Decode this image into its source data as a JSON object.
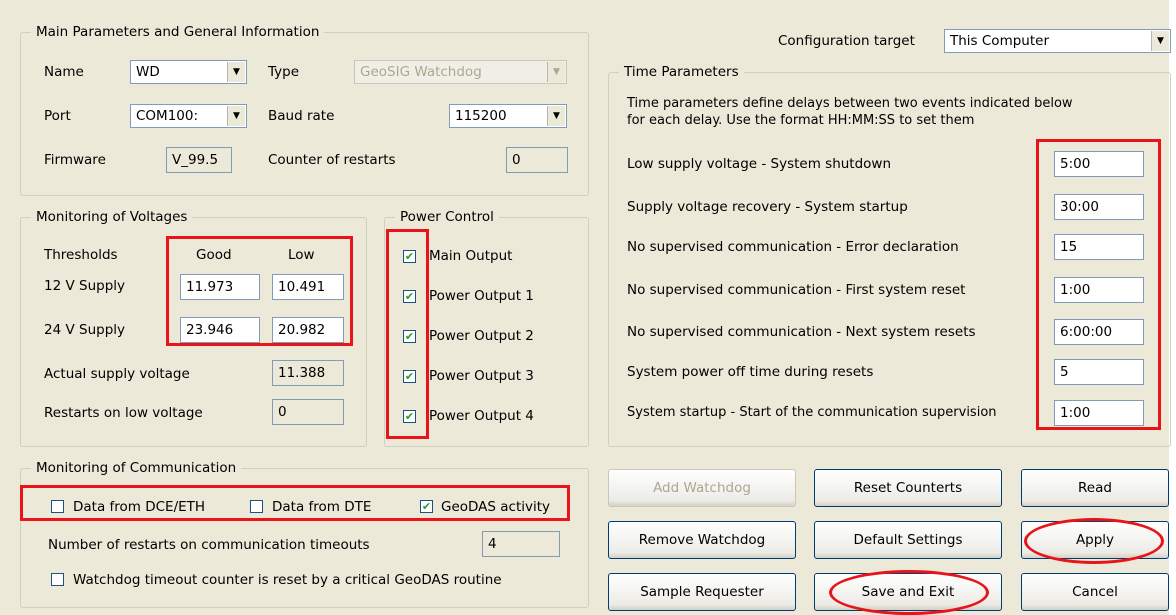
{
  "main_params": {
    "legend": "Main Parameters and General Information",
    "name_label": "Name",
    "name_value": "WD",
    "type_label": "Type",
    "type_value": "GeoSIG Watchdog",
    "port_label": "Port",
    "port_value": "COM100:",
    "baud_label": "Baud rate",
    "baud_value": "115200",
    "firmware_label": "Firmware",
    "firmware_value": "V_99.5",
    "restarts_label": "Counter of restarts",
    "restarts_value": "0"
  },
  "voltages": {
    "legend": "Monitoring of Voltages",
    "thresholds_label": "Thresholds",
    "good_header": "Good",
    "low_header": "Low",
    "supply12_label": "12 V Supply",
    "supply12_good": "11.973",
    "supply12_low": "10.491",
    "supply24_label": "24 V Supply",
    "supply24_good": "23.946",
    "supply24_low": "20.982",
    "actual_label": "Actual supply voltage",
    "actual_value": "11.388",
    "lowrestart_label": "Restarts on low voltage",
    "lowrestart_value": "0"
  },
  "power": {
    "legend": "Power Control",
    "outputs": [
      {
        "label": "Main Output",
        "checked": true
      },
      {
        "label": "Power Output 1",
        "checked": true
      },
      {
        "label": "Power Output 2",
        "checked": true
      },
      {
        "label": "Power Output 3",
        "checked": true
      },
      {
        "label": "Power Output 4",
        "checked": true
      }
    ]
  },
  "comm": {
    "legend": "Monitoring of Communication",
    "dce_label": "Data from DCE/ETH",
    "dce_checked": false,
    "dte_label": "Data from DTE",
    "dte_checked": false,
    "geodas_label": "GeoDAS activity",
    "geodas_checked": true,
    "timeout_label": "Number of restarts on communication timeouts",
    "timeout_value": "4",
    "critical_label": "Watchdog timeout counter is reset by a critical GeoDAS routine",
    "critical_checked": false
  },
  "config": {
    "label": "Configuration target",
    "value": "This Computer"
  },
  "time": {
    "legend": "Time Parameters",
    "desc1": "Time parameters define delays between two events indicated below",
    "desc2": "for each delay. Use the format HH:MM:SS to set them",
    "rows": [
      {
        "label": "Low supply voltage - System shutdown",
        "value": "5:00"
      },
      {
        "label": "Supply voltage recovery - System startup",
        "value": "30:00"
      },
      {
        "label": "No supervised communication - Error declaration",
        "value": "15"
      },
      {
        "label": "No supervised communication - First system reset",
        "value": "1:00"
      },
      {
        "label": "No supervised communication - Next system resets",
        "value": "6:00:00"
      },
      {
        "label": "System power off time during resets",
        "value": "5"
      },
      {
        "label": "System startup - Start of the communication supervision",
        "value": "1:00"
      }
    ]
  },
  "buttons": {
    "add": "Add Watchdog",
    "reset": "Reset Counterts",
    "read": "Read",
    "remove": "Remove Watchdog",
    "defaults": "Default Settings",
    "apply": "Apply",
    "sample": "Sample Requester",
    "save": "Save and Exit",
    "cancel": "Cancel"
  },
  "colors": {
    "dialog_bg": "#ece9d8",
    "annotation_red": "#e8141a",
    "input_border": "#7f9db9"
  }
}
